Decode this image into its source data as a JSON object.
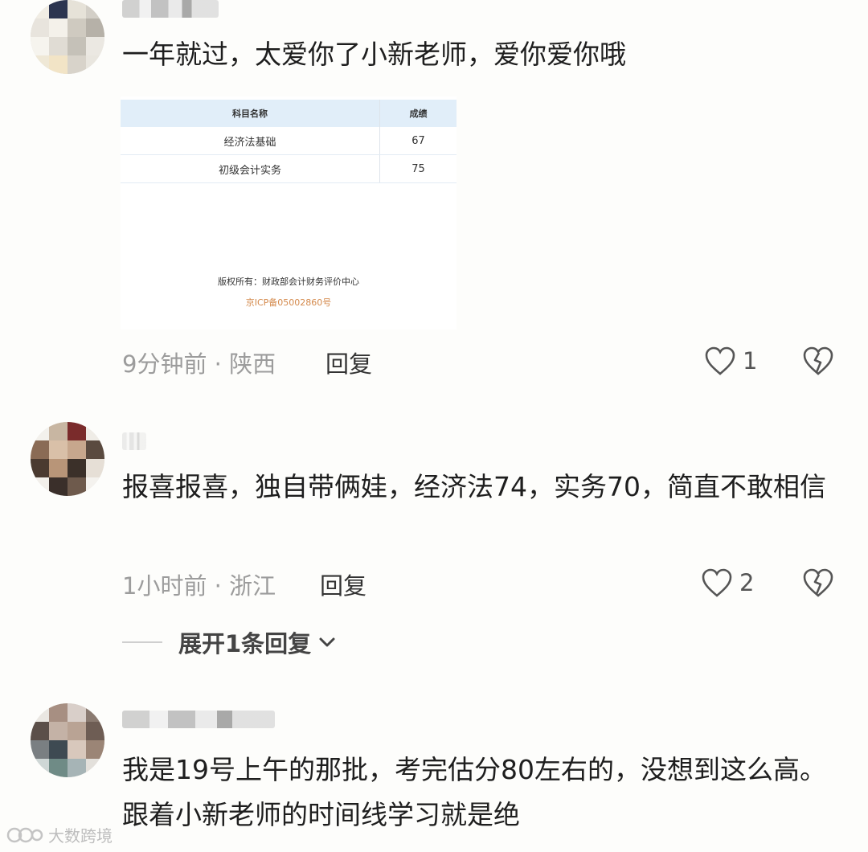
{
  "comments": [
    {
      "text": "一年就过，太爱你了小新老师，爱你爱你哦",
      "meta": "9分钟前 · 陕西",
      "reply_label": "回复",
      "like_count": "1",
      "score_image": {
        "headers": [
          "科目名称",
          "成绩"
        ],
        "rows": [
          [
            "经济法基础",
            "67"
          ],
          [
            "初级会计实务",
            "75"
          ]
        ],
        "copyright": "版权所有：财政部会计财务评价中心",
        "icp": "京ICP备05002860号"
      }
    },
    {
      "text": "报喜报喜，独自带俩娃，经济法74，实务70，简直不敢相信",
      "meta": "1小时前 · 浙江",
      "reply_label": "回复",
      "like_count": "2",
      "expand_label": "展开1条回复"
    },
    {
      "text": "我是19号上午的那批，考完估分80左右的，没想到这么高。跟着小新老师的时间线学习就是绝"
    }
  ],
  "watermark": "大数跨境",
  "icons": [
    "heart-outline-icon",
    "broken-heart-icon",
    "chevron-down-icon"
  ]
}
